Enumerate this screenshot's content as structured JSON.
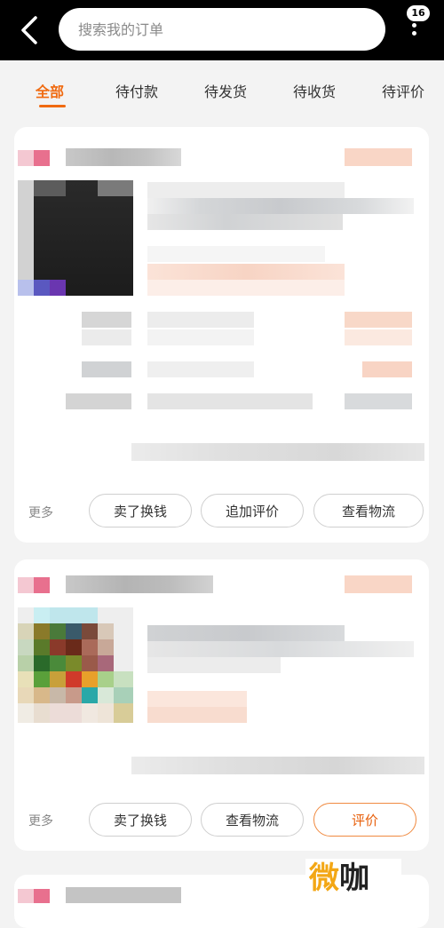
{
  "header": {
    "search_placeholder": "搜索我的订单",
    "badge_count": "16"
  },
  "tabs": [
    {
      "label": "全部",
      "active": true
    },
    {
      "label": "待付款"
    },
    {
      "label": "待发货"
    },
    {
      "label": "待收货"
    },
    {
      "label": "待评价"
    }
  ],
  "orders": [
    {
      "more_label": "更多",
      "buttons": [
        "卖了换钱",
        "追加评价",
        "查看物流"
      ]
    },
    {
      "more_label": "更多",
      "buttons": [
        "卖了换钱",
        "查看物流",
        "评价"
      ]
    }
  ],
  "watermark": {
    "part1": "微",
    "part2": "咖"
  },
  "colors": {
    "accent": "#f06a10",
    "topbar": "#000000",
    "background": "#f3f3f3"
  }
}
